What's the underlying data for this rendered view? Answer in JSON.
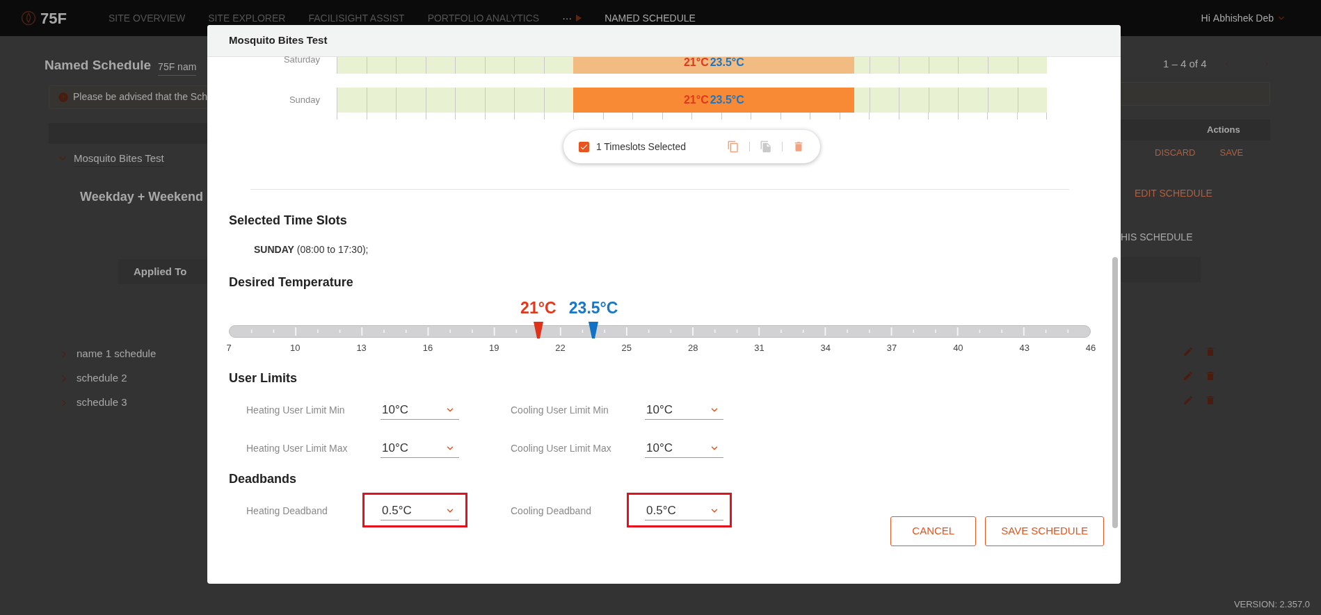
{
  "nav": {
    "logo": "75F",
    "items": [
      {
        "label": "SITE OVERVIEW",
        "selected": false
      },
      {
        "label": "SITE EXPLORER",
        "selected": false
      },
      {
        "label": "FACILISIGHT ASSIST",
        "selected": false
      },
      {
        "label": "PORTFOLIO ANALYTICS",
        "selected": false
      }
    ],
    "more": "···",
    "current": "NAMED SCHEDULE",
    "greeting": "Hi",
    "user": "Abhishek Deb"
  },
  "page": {
    "title": "Named Schedule",
    "filter_value": "75F nam",
    "notice": "Please be advised that the Sch",
    "pagination": "1 – 4 of 4",
    "actions_header": "Actions",
    "open_row": {
      "name": "Mosquito Bites Test",
      "expanded": true,
      "discard": "DISCARD",
      "save": "SAVE",
      "schedule_type": "Weekday + Weekend",
      "edit": "EDIT SCHEDULE",
      "action_2": "HIS SCHEDULE",
      "applied_to": "Applied To"
    },
    "rows": [
      {
        "name": "name 1 schedule",
        "expanded": false
      },
      {
        "name": "schedule 2",
        "expanded": false
      },
      {
        "name": "schedule 3",
        "expanded": false
      }
    ],
    "version": "VERSION: 2.357.0"
  },
  "dialog": {
    "title": "Mosquito Bites Test",
    "days": [
      {
        "name": "Saturday",
        "selected": false,
        "slots": [
          {
            "heating": "21°C",
            "cooling": "23.5°C"
          }
        ]
      },
      {
        "name": "Sunday",
        "selected": true,
        "slots": [
          {
            "heating": "21°C",
            "cooling": "23.5°C"
          }
        ]
      }
    ],
    "selection_bar": {
      "checked": true,
      "label": "1 Timeslots Selected",
      "tools": [
        {
          "kind": "copy",
          "disabled": false
        },
        {
          "kind": "paste",
          "disabled": true
        },
        {
          "kind": "delete",
          "disabled": false
        }
      ]
    },
    "selected_slots": {
      "heading": "Selected Time Slots",
      "text": "**SUNDAY** (08:00 to 17:30);"
    },
    "desired_temperature": {
      "heading": "Desired Temperature",
      "heating": {
        "reading": "21°C",
        "level": 0.359
      },
      "cooling": {
        "reading": "23.5°C",
        "level": 0.423
      },
      "scale": [
        "7",
        "10",
        "13",
        "16",
        "19",
        "22",
        "25",
        "28",
        "31",
        "34",
        "37",
        "40",
        "43",
        "46"
      ]
    },
    "user_limits": {
      "heading": "User Limits",
      "fields": [
        {
          "label": "Heating User Limit Min",
          "value": "10°C",
          "highlighted": false
        },
        {
          "label": "Cooling User Limit Min",
          "value": "10°C",
          "highlighted": false
        },
        {
          "label": "Heating User Limit Max",
          "value": "10°C",
          "highlighted": false
        },
        {
          "label": "Cooling User Limit Max",
          "value": "10°C",
          "highlighted": false
        }
      ]
    },
    "deadbands": {
      "heading": "Deadbands",
      "fields": [
        {
          "label": "Heating Deadband",
          "value": "0.5°C",
          "highlighted": true
        },
        {
          "label": "Cooling Deadband",
          "value": "0.5°C",
          "highlighted": true
        }
      ]
    },
    "buttons": [
      "CANCEL",
      "SAVE SCHEDULE"
    ]
  }
}
